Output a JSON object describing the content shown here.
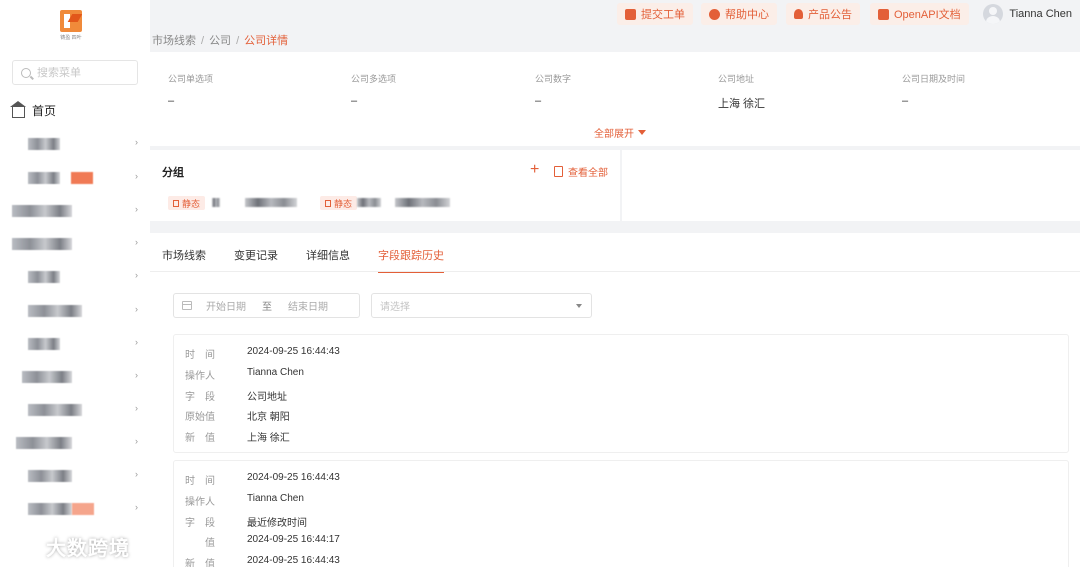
{
  "sidebar": {
    "logo_text": "铸盈 四叶",
    "search_placeholder": "搜索菜单",
    "home_label": "首页"
  },
  "topbar": {
    "buttons": [
      {
        "label": "提交工单",
        "icon": "ticket-icon"
      },
      {
        "label": "帮助中心",
        "icon": "help-icon"
      },
      {
        "label": "产品公告",
        "icon": "bell-icon"
      },
      {
        "label": "OpenAPI文档",
        "icon": "document-icon"
      }
    ],
    "user_name": "Tianna Chen"
  },
  "breadcrumb": {
    "items": [
      "市场线索",
      "公司"
    ],
    "current": "公司详情",
    "separator": "/"
  },
  "info": {
    "fields": [
      {
        "label": "公司单选项",
        "value": "–"
      },
      {
        "label": "公司多选项",
        "value": "–"
      },
      {
        "label": "公司数字",
        "value": "–"
      },
      {
        "label": "公司地址",
        "value": "上海 徐汇"
      },
      {
        "label": "公司日期及时间",
        "value": "–"
      }
    ],
    "expand_label": "全部展开"
  },
  "group": {
    "title": "分组",
    "add_symbol": "+",
    "view_all_label": "查看全部",
    "tags": [
      "静态",
      "静态"
    ]
  },
  "tabs": [
    "市场线索",
    "变更记录",
    "详细信息",
    "字段跟踪历史"
  ],
  "active_tab": "字段跟踪历史",
  "filters": {
    "start_placeholder": "开始日期",
    "to_label": "至",
    "end_placeholder": "结束日期",
    "select_placeholder": "请选择"
  },
  "records": [
    {
      "rows": [
        {
          "key": "时　间",
          "value": "2024-09-25 16:44:43"
        },
        {
          "key": "操作人",
          "value": "Tianna Chen"
        },
        {
          "key": "字　段",
          "value": "公司地址"
        },
        {
          "key": "原始值",
          "value": "北京 朝阳"
        },
        {
          "key": "新　值",
          "value": "上海 徐汇"
        }
      ]
    },
    {
      "rows": [
        {
          "key": "时　间",
          "value": "2024-09-25 16:44:43"
        },
        {
          "key": "操作人",
          "value": "Tianna Chen"
        },
        {
          "key": "字　段",
          "value": "最近修改时间"
        },
        {
          "key": "值",
          "value": "2024-09-25 16:44:17"
        },
        {
          "key": "新　值",
          "value": "2024-09-25 16:44:43"
        }
      ]
    }
  ],
  "watermark": "大数跨境",
  "colors": {
    "accent": "#e35f38",
    "accent_bg": "#fbeee8",
    "page_bg": "#f2f3f5"
  }
}
